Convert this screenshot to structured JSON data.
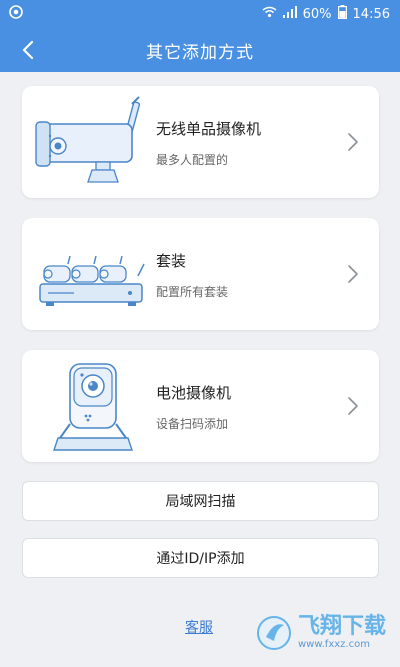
{
  "status_bar": {
    "battery": "60%",
    "time": "14:56"
  },
  "header": {
    "title": "其它添加方式"
  },
  "cards": [
    {
      "title": "无线单品摄像机",
      "subtitle": "最多人配置的"
    },
    {
      "title": "套装",
      "subtitle": "配置所有套装"
    },
    {
      "title": "电池摄像机",
      "subtitle": "设备扫码添加"
    }
  ],
  "buttons": {
    "lan_scan": "局域网扫描",
    "add_by_id": "通过ID/IP添加"
  },
  "links": {
    "customer_service": "客服"
  },
  "watermark": {
    "text": "飞翔下载",
    "url": "www.fxxz.com"
  },
  "colors": {
    "primary": "#4a90e2",
    "background": "#eef0f3",
    "line_art": "#4a86c8"
  }
}
